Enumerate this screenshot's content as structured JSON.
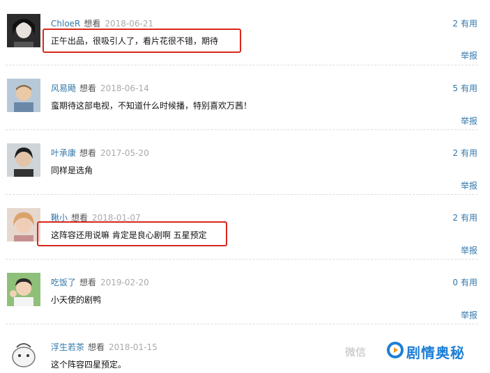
{
  "comments": [
    {
      "user": "ChloeR",
      "action": "想看",
      "date": "2018-06-21",
      "votes": "2",
      "vote_label": "有用",
      "text": "正午出品，很吸引人了，看片花很不错，期待",
      "report": "举报"
    },
    {
      "user": "风易飏",
      "action": "想看",
      "date": "2018-06-14",
      "votes": "5",
      "vote_label": "有用",
      "text": "蛮期待这部电视，不知道什么时候播，特别喜欢万茜！",
      "report": "举报"
    },
    {
      "user": "叶承康",
      "action": "想看",
      "date": "2017-05-20",
      "votes": "2",
      "vote_label": "有用",
      "text": "同样是选角",
      "report": "举报"
    },
    {
      "user": "鞦小",
      "action": "想看",
      "date": "2018-01-07",
      "votes": "2",
      "vote_label": "有用",
      "text": "这阵容还用说嘛 肯定是良心剧啊 五星预定",
      "report": "举报"
    },
    {
      "user": "吃饭了",
      "action": "想看",
      "date": "2019-02-20",
      "votes": "0",
      "vote_label": "有用",
      "text": "小天使的剧鸭",
      "report": "举报"
    },
    {
      "user": "浮生若茶",
      "action": "想看",
      "date": "2018-01-15",
      "votes": "",
      "vote_label": "",
      "text": "这个阵容四星预定。",
      "report": ""
    }
  ],
  "watermark": {
    "faint": "微信",
    "brand": "剧情奥秘"
  },
  "colors": {
    "link": "#3377aa",
    "highlight": "#d7271c",
    "brand": "#1e7fd6"
  }
}
